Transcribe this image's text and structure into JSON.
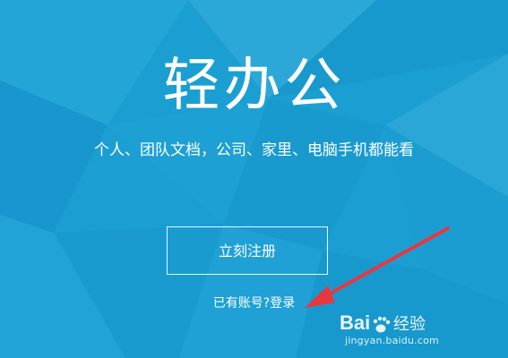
{
  "hero": {
    "title": "轻办公",
    "subtitle": "个人、团队文档，公司、家里、电脑手机都能看"
  },
  "actions": {
    "register_label": "立刻注册",
    "login_prompt": "已有账号?",
    "login_link": "登录"
  },
  "watermark": {
    "brand": "Baidu经验",
    "url": "jingyan.baidu.com"
  },
  "colors": {
    "background": "#1b9fd3",
    "text": "#ffffff",
    "annotation_arrow": "#e8373f"
  }
}
